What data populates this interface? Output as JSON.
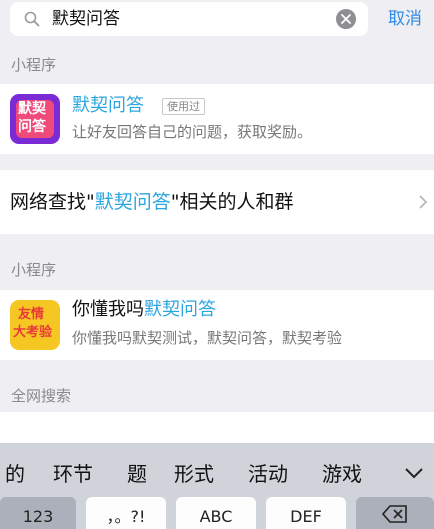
{
  "search": {
    "query": "默契问答",
    "cancel_label": "取消"
  },
  "section1": {
    "label": "小程序",
    "item": {
      "icon_text_top": "默契",
      "icon_text_bottom": "问答",
      "title": "默契问答",
      "badge": "使用过",
      "desc": "让好友回答自己的问题，获取奖励。"
    }
  },
  "network": {
    "prefix": "网络查找\"",
    "highlight": "默契问答",
    "suffix": "\"相关的人和群"
  },
  "section2": {
    "label": "小程序",
    "item": {
      "icon_text_top": "友情",
      "icon_text_bottom": "大考验",
      "title_prefix": "你懂我吗",
      "title_highlight": "默契问答",
      "desc": "你懂我吗默契测试，默契问答，默契考验"
    }
  },
  "section3": {
    "label": "全网搜索"
  },
  "keyboard": {
    "candidates": [
      "的",
      "环节",
      "题",
      "形式",
      "活动",
      "游戏"
    ],
    "keys": [
      "123",
      "，。?!",
      "ABC",
      "DEF"
    ]
  },
  "colors": {
    "accent": "#2ba6e1",
    "link": "#2f8be6",
    "icon1_bg": "#7b2bd6",
    "icon2_bg": "#f6c623"
  }
}
